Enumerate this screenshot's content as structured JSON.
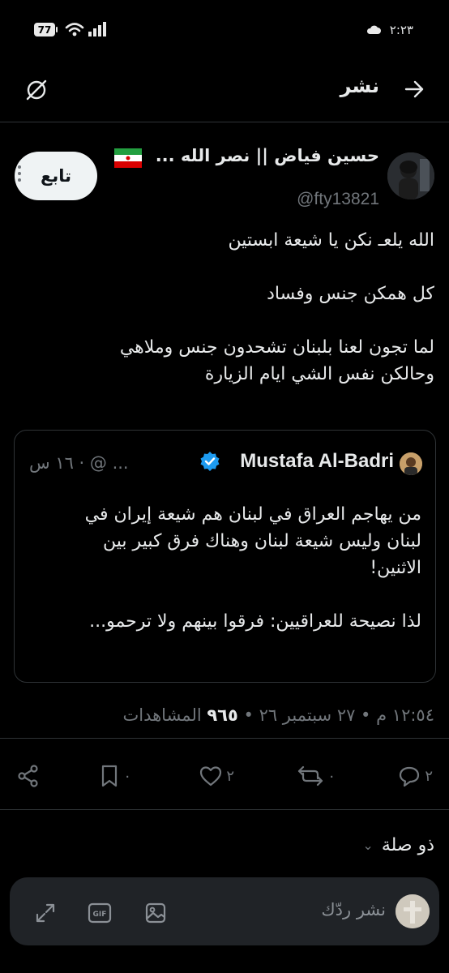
{
  "status_bar": {
    "battery": "77",
    "time": "٢:٢٣"
  },
  "header": {
    "title": "نشر"
  },
  "tweet": {
    "author_name": "حسين فياض || نصر الله ...",
    "handle": "@fty13821",
    "follow_label": "تابع",
    "text": "الله يلعـ نكن يا شيعة ابستين\n\nكل همكن جنس وفساد\n\nلما تجون لعنا بلبنان تشحدون جنس وملاهي\nوحالكن نفس الشي ايام الزيارة",
    "quote": {
      "author_name": "Mustafa Al-Badri",
      "meta": "... ‎@ · ١٦ س",
      "text": "من يهاجم العراق في لبنان هم شيعة إيران في\nلبنان وليس شيعة لبنان وهناك فرق كبير بين\nالاثنين!\n\nلذا نصيحة للعراقيين: فرقوا بينهم ولا ترحمو..."
    },
    "timestamp_prefix": "١٢:٥٤ م • ٢٧ سبتمبر ٢٦ • ",
    "views_count": "٩٦٥",
    "views_label": " المشاهدات",
    "actions": {
      "replies": "٢",
      "reposts": "٠",
      "likes": "٢",
      "bookmarks": "٠"
    }
  },
  "related_label": "ذو صلة",
  "reply_placeholder": "نشر ردّك",
  "colors": {
    "background": "#000000",
    "text": "#e7e9ea",
    "muted": "#71767b",
    "verified": "#1d9bf0",
    "follow_bg": "#eff3f4"
  }
}
